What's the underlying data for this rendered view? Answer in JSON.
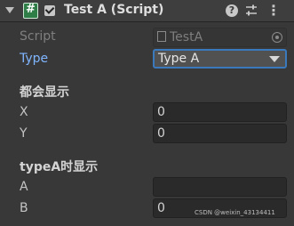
{
  "header": {
    "title": "Test A (Script)",
    "icons": [
      "chevron-down-icon",
      "csharp-script-icon",
      "enabled-checkbox-icon",
      "help-icon",
      "preset-sliders-icon",
      "context-menu-icon"
    ],
    "help_glyph": "?",
    "menu_glyph": "⋮"
  },
  "fields": {
    "script": {
      "label": "Script",
      "value": "TestA"
    },
    "type": {
      "label": "Type",
      "value": "Type A"
    }
  },
  "section1": {
    "title": "都会显示",
    "x": {
      "label": "X",
      "value": "0"
    },
    "y": {
      "label": "Y",
      "value": "0"
    }
  },
  "section2": {
    "title": "typeA时显示",
    "a": {
      "label": "A",
      "value": ""
    },
    "b": {
      "label": "B",
      "value": "0"
    }
  },
  "watermark": "CSDN @weixin_43134411",
  "colors": {
    "background": "#383838",
    "header": "#3e3e3e",
    "field_bg": "#2a2a2a",
    "dropdown_border": "#3a79bb",
    "label_highlight": "#7fb6ff",
    "script_icon": "#2f7d47"
  }
}
